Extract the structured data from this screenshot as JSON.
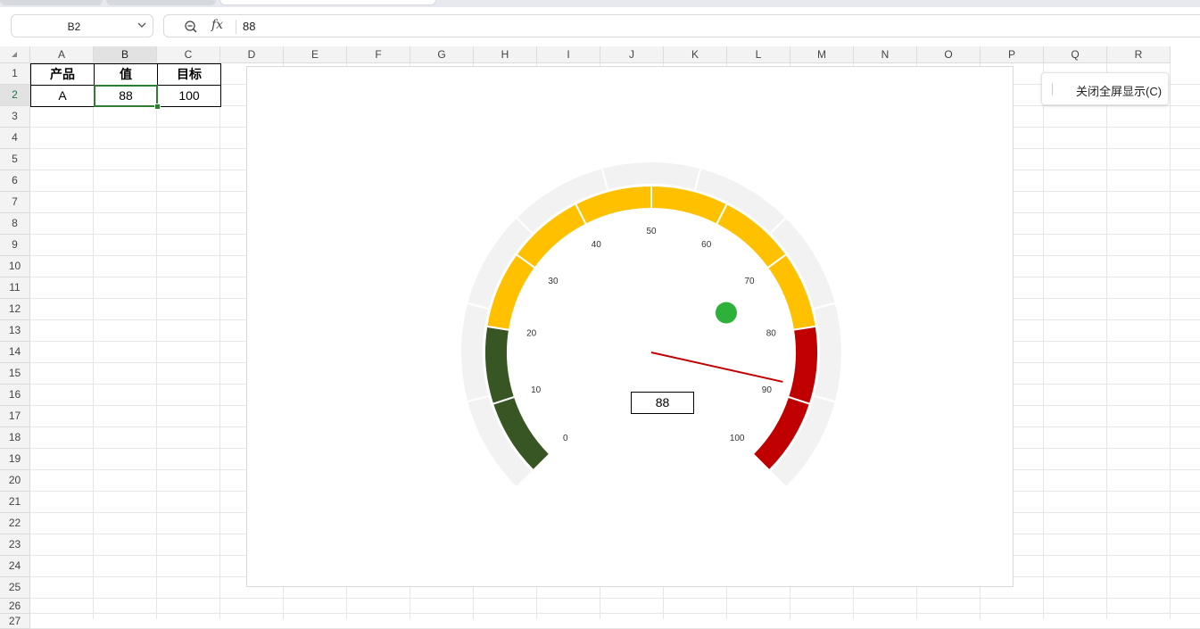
{
  "formula_bar": {
    "name_box": "B2",
    "fx_label": "fx",
    "value": "88"
  },
  "grid": {
    "columns": [
      "A",
      "B",
      "C",
      "D",
      "E",
      "F",
      "G",
      "H",
      "I",
      "J",
      "K",
      "L",
      "M",
      "N",
      "O",
      "P",
      "Q",
      "R"
    ],
    "selected_column": "B",
    "rows": [
      "1",
      "2",
      "3",
      "4",
      "5",
      "6",
      "7",
      "8",
      "9",
      "10",
      "11",
      "12",
      "13",
      "14",
      "15",
      "16",
      "17",
      "18",
      "19",
      "20",
      "21",
      "22",
      "23",
      "24",
      "25",
      "26",
      "27"
    ],
    "selected_row": "2"
  },
  "table": {
    "headers": [
      "产品",
      "值",
      "目标"
    ],
    "row": [
      "A",
      "88",
      "100"
    ]
  },
  "gauge": {
    "value": 88,
    "target": 100,
    "min": 0,
    "max": 100,
    "value_label": "88",
    "tick_labels": [
      "0",
      "10",
      "20",
      "30",
      "40",
      "50",
      "60",
      "70",
      "80",
      "90",
      "100"
    ],
    "bands": [
      {
        "from": 0,
        "to": 20,
        "color": "#375623"
      },
      {
        "from": 20,
        "to": 80,
        "color": "#FFC000"
      },
      {
        "from": 80,
        "to": 100,
        "color": "#C00000"
      }
    ],
    "outer_ring_color": "#F2F2F2",
    "needle_color": "#C00000",
    "marker_color": "#2DB13A"
  },
  "close_fullscreen_button": {
    "label": "关闭全屏显示(C)"
  }
}
